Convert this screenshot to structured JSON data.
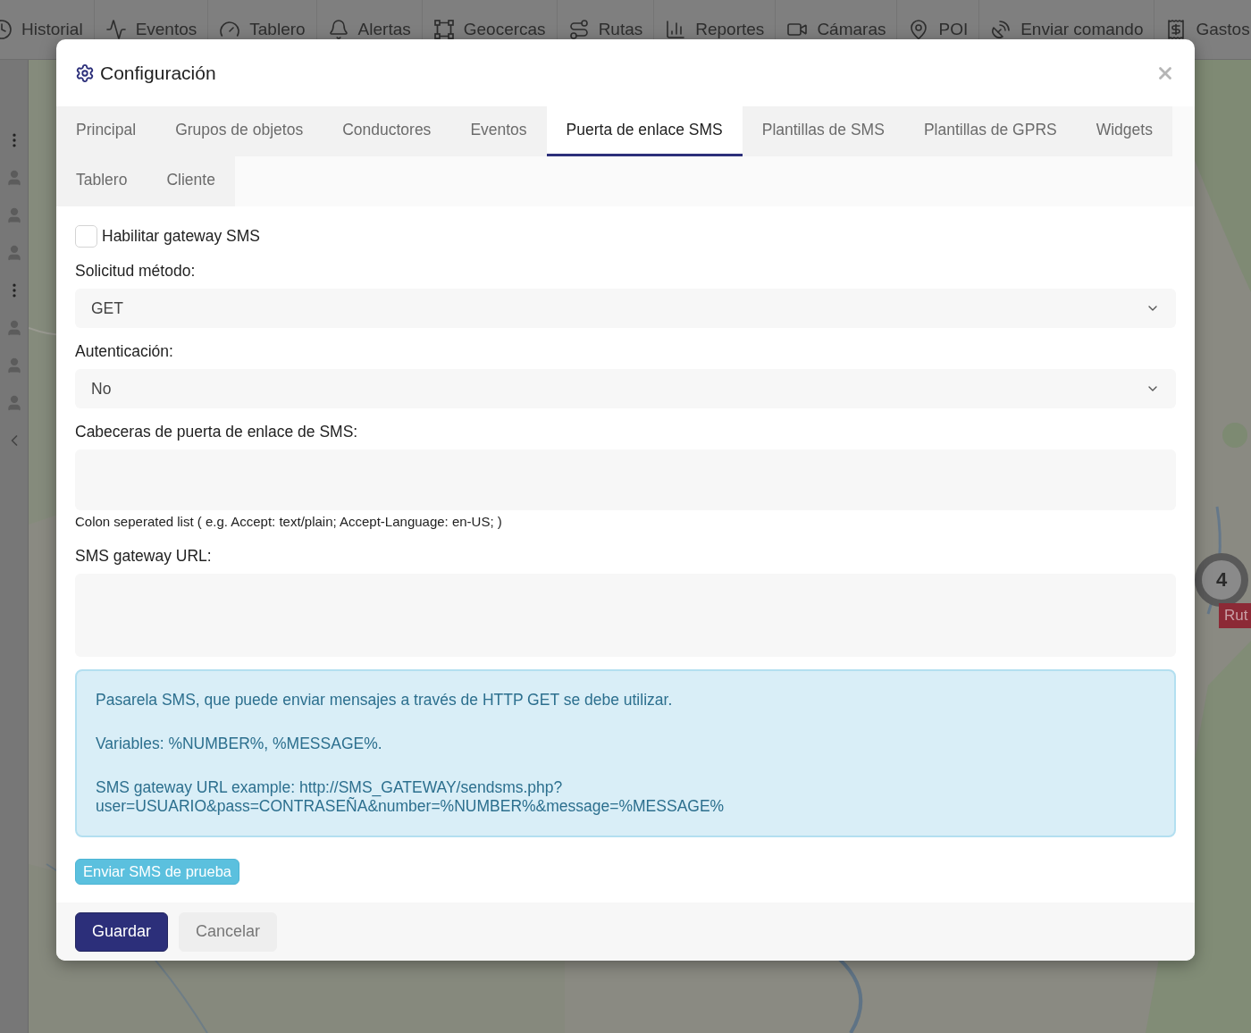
{
  "nav": {
    "items": [
      {
        "label": "Historial"
      },
      {
        "label": "Eventos"
      },
      {
        "label": "Tablero"
      },
      {
        "label": "Alertas"
      },
      {
        "label": "Geocercas"
      },
      {
        "label": "Rutas"
      },
      {
        "label": "Reportes"
      },
      {
        "label": "Cámaras"
      },
      {
        "label": "POI"
      },
      {
        "label": "Enviar comando"
      },
      {
        "label": "Gastos"
      }
    ]
  },
  "map": {
    "cluster_count": "4",
    "route_label": "Rut"
  },
  "modal": {
    "title": "Configuración",
    "tab_rows": [
      [
        {
          "label": "Principal",
          "selected": false
        },
        {
          "label": "Grupos de objetos",
          "selected": false
        },
        {
          "label": "Conductores",
          "selected": false
        },
        {
          "label": "Eventos",
          "selected": false
        },
        {
          "label": "Puerta de enlace SMS",
          "selected": true
        },
        {
          "label": "Plantillas de SMS",
          "selected": false
        },
        {
          "label": "Plantillas de GPRS",
          "selected": false
        },
        {
          "label": "Widgets",
          "selected": false
        }
      ],
      [
        {
          "label": "Tablero",
          "selected": false
        },
        {
          "label": "Cliente",
          "selected": false
        }
      ]
    ],
    "enable_gateway": {
      "label": "Habilitar gateway SMS",
      "checked": false
    },
    "fields": [
      {
        "kind": "select",
        "label": "Solicitud método:",
        "value": "GET"
      },
      {
        "kind": "select",
        "label": "Autenticación:",
        "value": "No"
      },
      {
        "kind": "textarea",
        "label": "Cabeceras de puerta de enlace de SMS:",
        "help": "Colon seperated list ( e.g. Accept: text/plain; Accept-Language: en-US; )"
      },
      {
        "kind": "textarea_large",
        "label": "SMS gateway URL:"
      }
    ],
    "info": [
      "Pasarela SMS, que puede enviar mensajes a través de HTTP GET se debe utilizar.",
      "Variables: %NUMBER%, %MESSAGE%.",
      "SMS gateway URL example: http://SMS_GATEWAY/sendsms.php?user=USUARIO&pass=CONTRASEÑA&number=%NUMBER%&message=%MESSAGE%"
    ],
    "test_button": "Enviar SMS de prueba",
    "footer": [
      {
        "label": "Guardar",
        "kind": "primary"
      },
      {
        "label": "Cancelar",
        "kind": "secondary"
      }
    ]
  }
}
